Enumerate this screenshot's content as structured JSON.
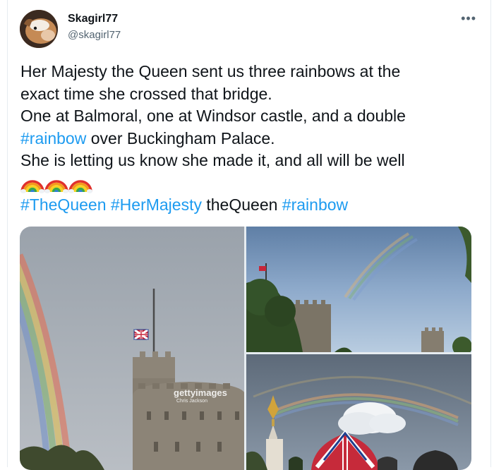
{
  "tweet": {
    "display_name": "Skagirl77",
    "handle": "@skagirl77",
    "more_icon": "more-dots-icon",
    "lines": {
      "l1": "Her Majesty the Queen sent us three rainbows at the",
      "l2": "exact time she crossed that bridge.",
      "l3a": "One at Balmoral, one at Windsor castle, and a double",
      "l4_tag": "#rainbow",
      "l4_rest": " over Buckingham Palace.",
      "l5": "She is letting us know she made it, and all will be well"
    },
    "emojis": [
      "rainbow-emoji",
      "rainbow-emoji",
      "rainbow-emoji"
    ],
    "hashtag_line": {
      "tag1": "#TheQueen",
      "tag2": "#HerMajesty",
      "plain": "theQueen",
      "tag3": "#rainbow"
    }
  },
  "media": {
    "watermark": "gettyimages",
    "watermark_credit": "Chris Jackson",
    "images": [
      "windsor-castle-rainbow-photo",
      "windsor-tower-rainbow-photo",
      "buckingham-palace-double-rainbow-photo"
    ]
  },
  "colors": {
    "link": "#1d9bf0",
    "text": "#0f1419",
    "secondary": "#536471"
  }
}
